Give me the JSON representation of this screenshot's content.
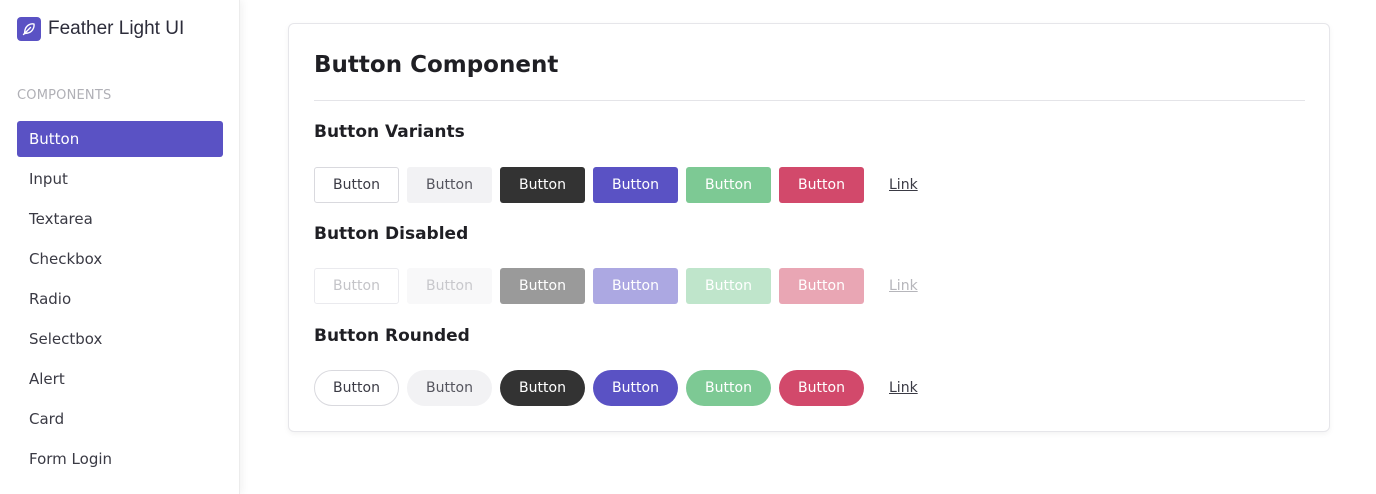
{
  "brand": {
    "name": "Feather Light UI",
    "icon": "feather-icon",
    "accent": "#5a52c4"
  },
  "sidebar": {
    "section_label": "COMPONENTS",
    "items": [
      {
        "label": "Button",
        "active": true
      },
      {
        "label": "Input"
      },
      {
        "label": "Textarea"
      },
      {
        "label": "Checkbox"
      },
      {
        "label": "Radio"
      },
      {
        "label": "Selectbox"
      },
      {
        "label": "Alert"
      },
      {
        "label": "Card"
      },
      {
        "label": "Form Login"
      }
    ]
  },
  "main": {
    "title": "Button Component",
    "groups": [
      {
        "title": "Button Variants",
        "buttons": [
          "Button",
          "Button",
          "Button",
          "Button",
          "Button",
          "Button"
        ],
        "link": "Link"
      },
      {
        "title": "Button Disabled",
        "buttons": [
          "Button",
          "Button",
          "Button",
          "Button",
          "Button",
          "Button"
        ],
        "link": "Link"
      },
      {
        "title": "Button Rounded",
        "buttons": [
          "Button",
          "Button",
          "Button",
          "Button",
          "Button",
          "Button"
        ],
        "link": "Link"
      }
    ]
  },
  "colors": {
    "primary": "#5a52c4",
    "dark": "#333333",
    "success": "#7dc994",
    "danger": "#d2496b",
    "light": "#f2f2f4"
  }
}
